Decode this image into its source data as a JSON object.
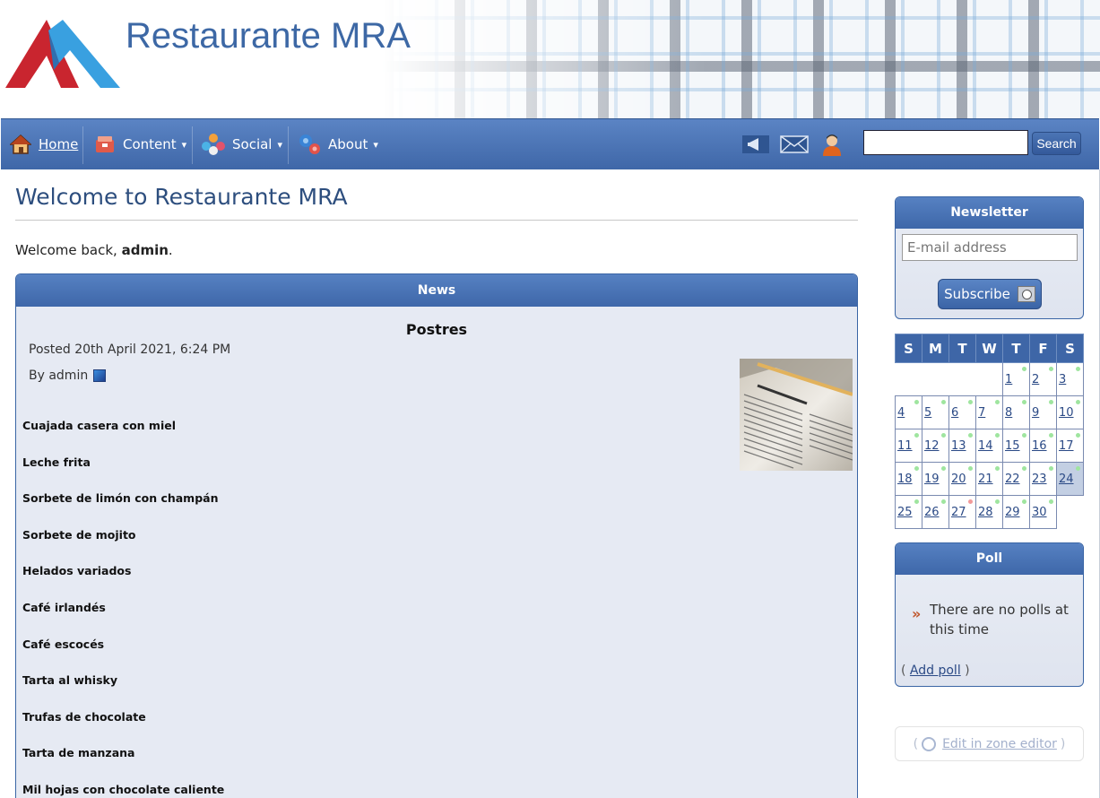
{
  "header": {
    "site_name": "Restaurante MRA",
    "brand_color": "#3d68a5"
  },
  "nav": {
    "home": "Home",
    "content": "Content",
    "social": "Social",
    "about": "About",
    "caret": "▾",
    "search_label": "Search",
    "search_value": ""
  },
  "main": {
    "title": "Welcome to Restaurante MRA",
    "welcome_prefix": "Welcome back, ",
    "welcome_user": "admin",
    "welcome_suffix": "."
  },
  "news": {
    "header": "News",
    "title": "Postres",
    "posted": "Posted 20th April 2021, 6:24 PM",
    "by": "By admin",
    "items": [
      "Cuajada casera con miel",
      "Leche frita",
      "Sorbete de limón con champán",
      "Sorbete de mojito",
      "Helados variados",
      "Café irlandés",
      "Café escocés",
      "Tarta al whisky",
      "Trufas de chocolate",
      "Tarta de manzana",
      "Mil hojas con chocolate caliente"
    ]
  },
  "newsletter": {
    "header": "Newsletter",
    "email_placeholder": "E-mail address",
    "subscribe": "Subscribe"
  },
  "calendar": {
    "weekdays": [
      "S",
      "M",
      "T",
      "W",
      "T",
      "F",
      "S"
    ],
    "weeks": [
      [
        "",
        "",
        "",
        "",
        "1",
        "2",
        "3"
      ],
      [
        "4",
        "5",
        "6",
        "7",
        "8",
        "9",
        "10"
      ],
      [
        "11",
        "12",
        "13",
        "14",
        "15",
        "16",
        "17"
      ],
      [
        "18",
        "19",
        "20",
        "21",
        "22",
        "23",
        "24"
      ],
      [
        "25",
        "26",
        "27",
        "28",
        "29",
        "30",
        ""
      ]
    ],
    "today": "24",
    "red_day": "27"
  },
  "poll": {
    "header": "Poll",
    "arrow": "»",
    "message": "There are no polls at this time",
    "add_open": "(",
    "add_link": "Add poll",
    "add_close": ")"
  },
  "zone_editor": {
    "open": "(",
    "link": "Edit in zone editor",
    "close": ")"
  }
}
